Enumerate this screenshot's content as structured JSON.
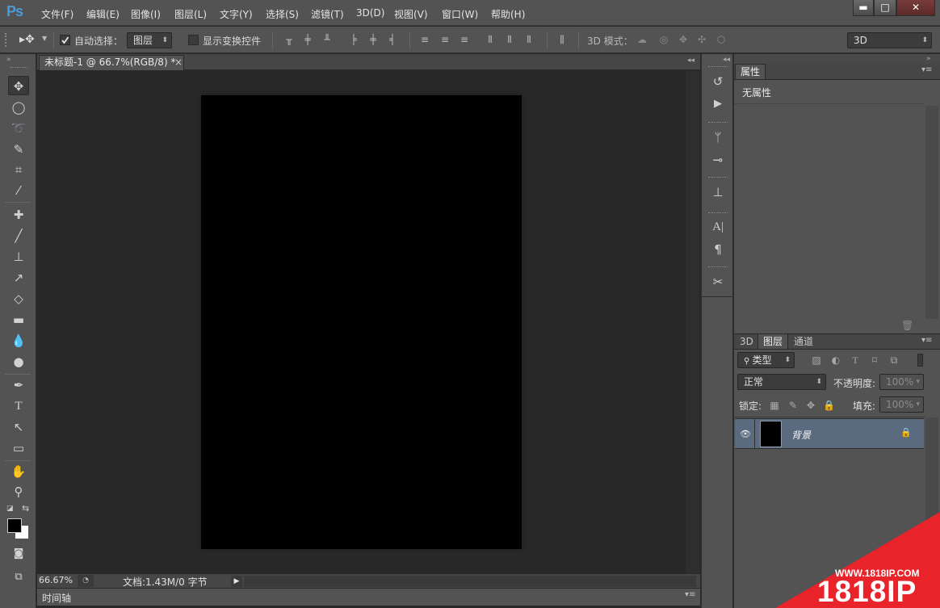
{
  "app": {
    "logo": "Ps"
  },
  "menu": [
    "文件(F)",
    "编辑(E)",
    "图像(I)",
    "图层(L)",
    "文字(Y)",
    "选择(S)",
    "滤镜(T)",
    "3D(D)",
    "视图(V)",
    "窗口(W)",
    "帮助(H)"
  ],
  "window_controls": {
    "minimize": "▬",
    "maximize": "□",
    "close": "✕"
  },
  "options": {
    "auto_select_label": "自动选择：",
    "auto_select_checked": true,
    "auto_select_target": "图层",
    "show_transform_label": "显示变换控件",
    "show_transform_checked": false,
    "mode_3d_label": "3D 模式：",
    "workspace": "3D"
  },
  "document": {
    "tab_title": "未标题-1 @ 66.7%(RGB/8) *",
    "tab_close": "×",
    "zoom": "66.67%",
    "doc_info": "文档:1.43M/0 字节",
    "canvas_color": "#000000"
  },
  "timeline": {
    "label": "时间轴"
  },
  "properties_panel": {
    "tab": "属性",
    "content": "无属性"
  },
  "layers_panel": {
    "tabs": [
      "3D",
      "图层",
      "通道"
    ],
    "active_tab": "图层",
    "filter_kind": "类型",
    "blend_mode": "正常",
    "opacity_label": "不透明度:",
    "opacity_value": "100%",
    "lock_label": "锁定:",
    "fill_label": "填充:",
    "fill_value": "100%",
    "layers": [
      {
        "name": "背景",
        "visible": true,
        "locked": true
      }
    ]
  },
  "watermark": {
    "url": "WWW.1818IP.COM",
    "brand": "1818IP"
  }
}
